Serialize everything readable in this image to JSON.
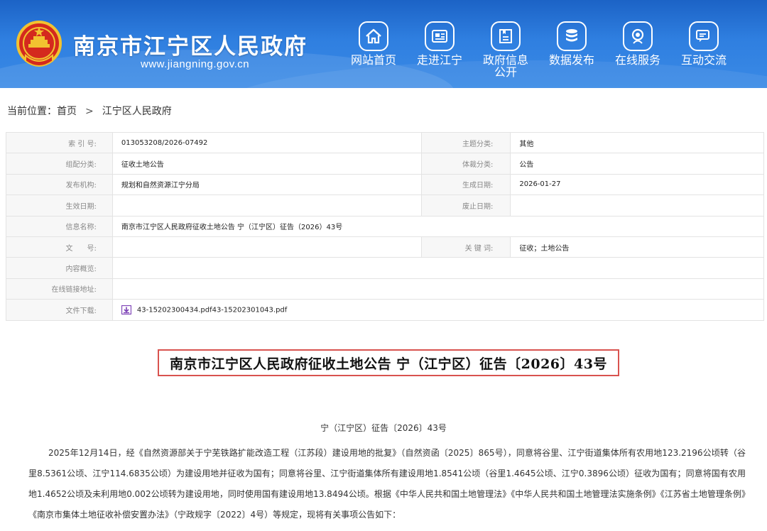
{
  "header": {
    "site_title": "南京市江宁区人民政府",
    "site_url": "www.jiangning.gov.cn",
    "nav": [
      {
        "label": "网站首页",
        "icon": "home-icon"
      },
      {
        "label": "走进江宁",
        "icon": "newspaper-icon"
      },
      {
        "label": "政府信息公开",
        "line1": "政府信息",
        "line2": "公开",
        "icon": "document-icon"
      },
      {
        "label": "数据发布",
        "icon": "database-icon"
      },
      {
        "label": "在线服务",
        "icon": "search-service-icon"
      },
      {
        "label": "互动交流",
        "icon": "chat-icon"
      }
    ]
  },
  "breadcrumb": {
    "prefix": "当前位置：",
    "items": [
      "首页",
      "江宁区人民政府"
    ],
    "separator": ">"
  },
  "info": {
    "index_label": "索 引 号:",
    "index_value": "013053208/2026-07492",
    "topic_label": "主题分类:",
    "topic_value": "其他",
    "category_label": "组配分类:",
    "category_value": "征收土地公告",
    "genre_label": "体裁分类:",
    "genre_value": "公告",
    "publisher_label": "发布机构:",
    "publisher_value": "规划和自然资源江宁分局",
    "created_label": "生成日期:",
    "created_value": "2026-01-27",
    "effective_label": "生效日期:",
    "effective_value": "",
    "repeal_label": "废止日期:",
    "repeal_value": "",
    "name_label": "信息名称:",
    "name_value": "南京市江宁区人民政府征收土地公告 宁（江宁区）征告（2026）43号",
    "docno_label": "文　　号:",
    "docno_value": "",
    "keywords_label": "关 键 词:",
    "keywords_value": "征收；土地公告",
    "summary_label": "内容概览:",
    "summary_value": "",
    "link_label": "在线链接地址:",
    "link_value": "",
    "file_label": "文件下载:",
    "file_value": "43-15202300434.pdf43-15202301043.pdf"
  },
  "article": {
    "title": "南京市江宁区人民政府征收土地公告 宁（江宁区）征告〔2026〕43号",
    "number": "宁（江宁区）征告〔2026〕43号",
    "paragraph": "2025年12月14日，经《自然资源部关于宁芜铁路扩能改造工程（江苏段）建设用地的批复》（自然资函〔2025〕865号），同意将谷里、江宁街道集体所有农用地123.2196公顷转（谷里8.5361公顷、江宁114.6835公顷）为建设用地并征收为国有；同意将谷里、江宁街道集体所有建设用地1.8541公顷（谷里1.4645公顷、江宁0.3896公顷）征收为国有；同意将国有农用地1.4652公顷及未利用地0.002公顷转为建设用地，同时使用国有建设用地13.8494公顷。根据《中华人民共和国土地管理法》《中华人民共和国土地管理法实施条例》《江苏省土地管理条例》《南京市集体土地征收补偿安置办法》（宁政规字〔2022〕4号）等规定，现将有关事项公告如下："
  },
  "colors": {
    "header_top": "#1c63c6",
    "header_bottom": "#3a8ae6",
    "highlight_border": "#d9534f",
    "label_bg": "#f7f7f7",
    "download_icon": "#7b3fb5"
  }
}
